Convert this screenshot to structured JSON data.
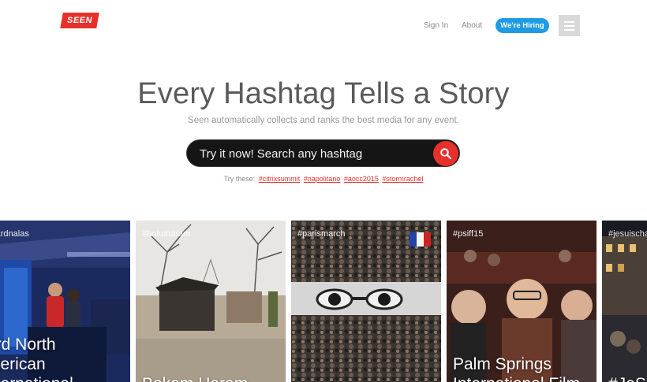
{
  "header": {
    "logo_text": "SEEN",
    "nav": {
      "signin": "Sign In",
      "about": "About"
    },
    "hiring_label": "We're Hiring",
    "accent_color": "#1e9be3",
    "brand_color": "#e8302a"
  },
  "hero": {
    "title": "Every Hashtag Tells a Story",
    "subtitle": "Seen automatically collects and ranks the best media for any event."
  },
  "search": {
    "placeholder": "Try it now! Search any hashtag",
    "button_icon": "search-icon"
  },
  "suggestions": {
    "label": "Try these:",
    "tags": [
      "#citrixsummit",
      "#napolitano",
      "#aocc2015",
      "#stormrachel"
    ]
  },
  "cards": [
    {
      "tag": "#cardnalas",
      "title": "ord North\nmerican\nnternational"
    },
    {
      "tag": "#bokoharam",
      "title": "Bokom Haram"
    },
    {
      "tag": "#parismarch",
      "title": ""
    },
    {
      "tag": "#psiff15",
      "title": "Palm Springs\nInternational Film"
    },
    {
      "tag": "#jesuischarlie",
      "title": "#JeS"
    }
  ]
}
